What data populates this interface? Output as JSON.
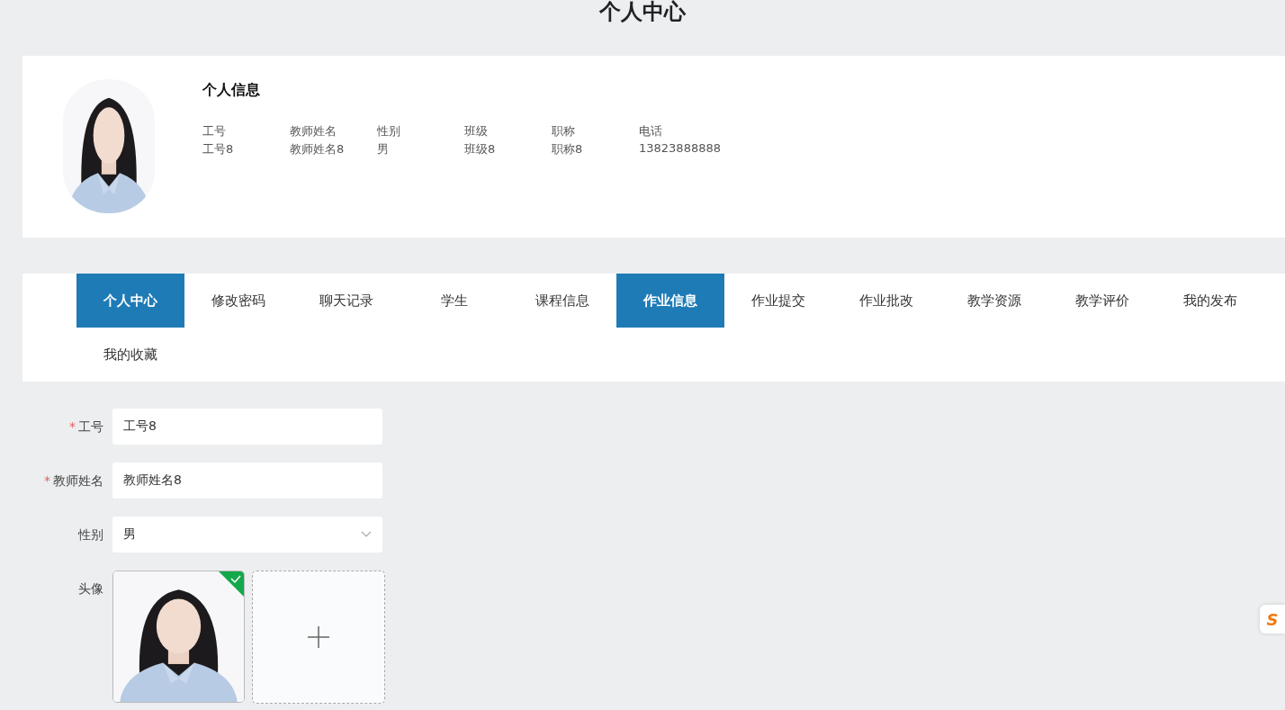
{
  "page_title": "个人中心",
  "profile": {
    "heading": "个人信息",
    "fields": [
      {
        "label": "工号",
        "value": "工号8"
      },
      {
        "label": "教师姓名",
        "value": "教师姓名8"
      },
      {
        "label": "性别",
        "value": "男"
      },
      {
        "label": "班级",
        "value": "班级8"
      },
      {
        "label": "职称",
        "value": "职称8"
      },
      {
        "label": "电话",
        "value": "13823888888"
      }
    ]
  },
  "tabs": [
    {
      "label": "个人中心",
      "selected": true
    },
    {
      "label": "修改密码",
      "selected": false
    },
    {
      "label": "聊天记录",
      "selected": false
    },
    {
      "label": "学生",
      "selected": false
    },
    {
      "label": "课程信息",
      "selected": false
    },
    {
      "label": "作业信息",
      "selected": true
    },
    {
      "label": "作业提交",
      "selected": false
    },
    {
      "label": "作业批改",
      "selected": false
    },
    {
      "label": "教学资源",
      "selected": false
    },
    {
      "label": "教学评价",
      "selected": false
    },
    {
      "label": "我的发布",
      "selected": false
    },
    {
      "label": "我的收藏",
      "selected": false
    }
  ],
  "form": [
    {
      "kind": "input",
      "label": "工号",
      "required": true,
      "value": "工号8"
    },
    {
      "kind": "input",
      "label": "教师姓名",
      "required": true,
      "value": "教师姓名8"
    },
    {
      "kind": "select",
      "label": "性别",
      "required": false,
      "value": "男"
    },
    {
      "kind": "upload",
      "label": "头像",
      "required": false,
      "uploaded": true
    }
  ],
  "required_mark": "*",
  "side_badge": "S"
}
